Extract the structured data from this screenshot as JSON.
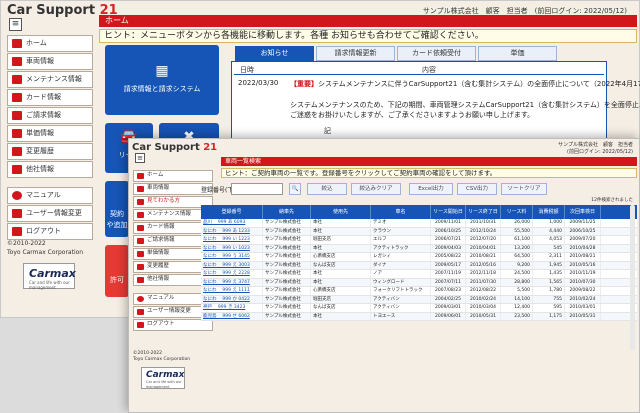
{
  "back": {
    "logo": {
      "text": "Car Support",
      "num": "21"
    },
    "header_info": "サンプル株式会社　顧客　担当者　(前回ログイン: 2022/05/12)",
    "menu_icon": "hamburger-icon",
    "page_title": "ホーム",
    "hint": "ヒント：メニューボタンから各機能に移動します。各種 お知らせも合わせてご確認ください。",
    "sidebar": [
      {
        "label": "ホーム",
        "icon": "home-icon"
      },
      {
        "label": "車両情報",
        "icon": "car-icon"
      },
      {
        "label": "メンテナンス情報",
        "icon": "wrench-icon"
      },
      {
        "label": "カード情報",
        "icon": "card-icon"
      },
      {
        "label": "ご請求情報",
        "icon": "invoice-icon"
      },
      {
        "label": "単価情報",
        "icon": "price-icon"
      },
      {
        "label": "変更履歴",
        "icon": "history-icon"
      },
      {
        "label": "他社情報",
        "icon": "building-icon"
      },
      {
        "label": "マニュアル",
        "icon": "help-icon"
      },
      {
        "label": "ユーザー情報変更",
        "icon": "user-icon"
      },
      {
        "label": "ログアウト",
        "icon": "logout-icon"
      }
    ],
    "copyright": [
      "©2010-2022",
      "Toyo Carmax Corporation"
    ],
    "brand": {
      "name": "Carmax",
      "sub": "Car and life with our management",
      "color": "#d0171b"
    },
    "tiles": [
      {
        "label": "請求情報と請求システム",
        "icon": "table-icon"
      },
      {
        "label": "リース",
        "icon": "car-icon"
      },
      {
        "label": "なし",
        "icon": "tools-icon"
      },
      {
        "label": "契約",
        "icon": "doc-icon"
      },
      {
        "label": "や追加",
        "icon": "doc-icon"
      },
      {
        "label": "許可",
        "icon": "doc-icon"
      }
    ],
    "tabs": [
      {
        "label": "お知らせ",
        "active": true
      },
      {
        "label": "請求情報更新",
        "active": false
      },
      {
        "label": "カード依頼受付",
        "active": false
      },
      {
        "label": "単価",
        "active": false
      }
    ],
    "news": {
      "col_date": "日時",
      "col_content": "内容",
      "date": "2022/03/30",
      "tag": "【重要】",
      "headline": "システムメンテナンスに伴うCarSupport21（含む集計システム）の全面停止について（2022年4月17…",
      "body1": "システムメンテナンスのため、下記の期間、車両管理システムCarSupport21（含む集計システム）を全面停止…",
      "body2": "ご迷惑をお掛けいたしますが、ご了承くださいますようお願い申し上げます。",
      "mark": "記"
    }
  },
  "front": {
    "logo": {
      "text": "Car Support",
      "num": "21"
    },
    "header_info": [
      "サンプル株式会社　顧客　担当者",
      "(前回ログイン: 2022/05/12)"
    ],
    "menu_icon": "hamburger-icon",
    "page_title": "車両一覧検索",
    "hint": "ヒント：ご契約車両の一覧です。登録番号をクリックしてご契約車両の確認をして頂けます。",
    "sidebar": [
      {
        "label": "ホーム",
        "icon": "home-icon",
        "hl": false
      },
      {
        "label": "車両情報",
        "icon": "car-icon",
        "hl": false
      },
      {
        "label": "見てわかる方",
        "icon": "pointer-icon",
        "hl": true
      },
      {
        "label": "メンテナンス情報",
        "icon": "wrench-icon",
        "hl": false
      },
      {
        "label": "カード情報",
        "icon": "card-icon",
        "hl": false
      },
      {
        "label": "ご請求情報",
        "icon": "invoice-icon",
        "hl": false
      },
      {
        "label": "単価情報",
        "icon": "price-icon",
        "hl": false
      },
      {
        "label": "変更履歴",
        "icon": "history-icon",
        "hl": false
      },
      {
        "label": "他社情報",
        "icon": "building-icon",
        "hl": false
      },
      {
        "label": "マニュアル",
        "icon": "help-icon",
        "hl": false
      },
      {
        "label": "ユーザー情報変更",
        "icon": "user-icon",
        "hl": false
      },
      {
        "label": "ログアウト",
        "icon": "logout-icon",
        "hl": false
      }
    ],
    "copyright": [
      "©2010-2022",
      "Toyo Carmax Corporation"
    ],
    "brand": {
      "name": "Carmax",
      "sub": "Car and life with our management"
    },
    "search": {
      "label": "登録番号(下4桁)",
      "value": "",
      "buttons": [
        "絞込",
        "絞込みクリア",
        "Excel出力",
        "CSV出力",
        "ソートクリア"
      ]
    },
    "count": "12件検索されました",
    "columns": [
      "登録番号",
      "納車先",
      "使用先",
      "車名",
      "リース開始日",
      "リース終了日",
      "リース料",
      "消費税額",
      "次回車検日"
    ],
    "rows": [
      [
        "品川 　999 あ 6093",
        "サンプル株式会社",
        "本社",
        "デミオ",
        "2009/11/01",
        "2011/10/31",
        "26,000",
        "1,000",
        "2009/11/25"
      ],
      [
        "なにわ 　999 あ 1233",
        "サンプル株式会社",
        "本社",
        "クラウン",
        "2006/10/25",
        "2012/10/24",
        "55,500",
        "4,440",
        "2006/10/25"
      ],
      [
        "なにわ 　999 い 1223",
        "サンプル株式会社",
        "堀田支店",
        "エルフ",
        "2006/07/21",
        "2012/07/20",
        "61,100",
        "4,053",
        "2009/07/20"
      ],
      [
        "なにわ 　999 い 1023",
        "サンプル株式会社",
        "本社",
        "アクティトラック",
        "2009/04/03",
        "2010/04/01",
        "13,200",
        "545",
        "2010/04/28"
      ],
      [
        "なにわ 　999 う 3145",
        "サンプル株式会社",
        "心斎橋支店",
        "レガシィ",
        "2005/08/22",
        "2010/08/21",
        "64,500",
        "2,311",
        "2010/08/21"
      ],
      [
        "なにわ 　999 え 3003",
        "サンプル株式会社",
        "なんば支店",
        "ダイナ",
        "2009/05/17",
        "2012/05/16",
        "9,200",
        "1,945",
        "2010/05/16"
      ],
      [
        "なにわ 　999 え 2228",
        "サンプル株式会社",
        "本社",
        "ノア",
        "2007/11/19",
        "2012/11/18",
        "24,500",
        "1,435",
        "2010/11/19"
      ],
      [
        "なにわ 　999 え 3747",
        "サンプル株式会社",
        "本社",
        "ウィングロード",
        "2007/07/11",
        "2011/07/30",
        "28,800",
        "1,565",
        "2010/07/30"
      ],
      [
        "なにわ 　999 え 1111",
        "サンプル株式会社",
        "心斎橋支店",
        "フォークリフトトラック",
        "2007/08/23",
        "2012/08/22",
        "5,500",
        "1,780",
        "2009/08/22"
      ],
      [
        "なにわ 　999 か 0422",
        "サンプル株式会社",
        "堀田支店",
        "アクティバン",
        "2004/02/25",
        "2010/02/24",
        "14,100",
        "755",
        "2010/02/24"
      ],
      [
        "神戸 　999 き 3423",
        "サンプル株式会社",
        "なんば支店",
        "アクティバン",
        "2009/03/01",
        "2010/03/04",
        "12,400",
        "595",
        "2010/03/01"
      ],
      [
        "鹿児島 　999 せ 6062",
        "サンプル株式会社",
        "本社",
        "トヨエース",
        "2009/06/01",
        "2010/05/31",
        "23,500",
        "1,175",
        "2010/05/31"
      ]
    ]
  }
}
